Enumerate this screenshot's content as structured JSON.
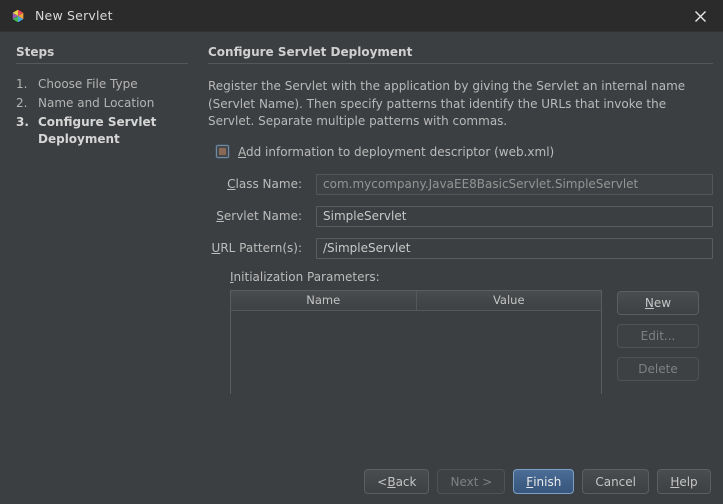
{
  "window": {
    "title": "New Servlet",
    "app_icon": "netbeans-logo-icon",
    "close_icon": "close-icon"
  },
  "steps_panel": {
    "heading": "Steps",
    "items": [
      {
        "number": "1.",
        "label": "Choose File Type",
        "current": false
      },
      {
        "number": "2.",
        "label": "Name and Location",
        "current": false
      },
      {
        "number": "3.",
        "label": "Configure Servlet Deployment",
        "current": true
      }
    ]
  },
  "main": {
    "heading": "Configure Servlet Deployment",
    "description": "Register the Servlet with the application by giving the Servlet an internal name (Servlet Name). Then specify patterns that identify the URLs that invoke the Servlet. Separate multiple patterns with commas.",
    "deployment_descriptor_checkbox": {
      "label_before": "A",
      "label_mnemonic": "A",
      "label": "Add information to deployment descriptor (web.xml)",
      "checked": false
    },
    "fields": [
      {
        "label": "Class Name:",
        "mnemonic": "C",
        "label_rest": "lass Name:",
        "value": "com.mycompany.JavaEE8BasicServlet.SimpleServlet",
        "placeholder": "",
        "disabled": true
      },
      {
        "label": "Servlet Name:",
        "mnemonic": "S",
        "label_rest": "ervlet Name:",
        "value": "SimpleServlet",
        "placeholder": "",
        "disabled": false
      },
      {
        "label": "URL Pattern(s):",
        "mnemonic": "U",
        "label_rest": "RL Pattern(s):",
        "value": "/SimpleServlet",
        "placeholder": "",
        "disabled": false
      }
    ],
    "init_params": {
      "label": "Initialization Parameters:",
      "mnemonic": "I",
      "label_rest": "nitialization Parameters:",
      "columns": [
        "Name",
        "Value"
      ],
      "rows": [],
      "buttons": [
        {
          "label": "New",
          "mnemonic": "N",
          "label_rest": "ew",
          "disabled": false
        },
        {
          "label": "Edit...",
          "mnemonic": "",
          "label_rest": "Edit...",
          "disabled": true
        },
        {
          "label": "Delete",
          "mnemonic": "",
          "label_rest": "Delete",
          "disabled": true
        }
      ]
    }
  },
  "footer": {
    "buttons": [
      {
        "label": "< Back",
        "prefix": "< ",
        "mnemonic": "B",
        "suffix": "ack",
        "disabled": false,
        "default": false
      },
      {
        "label": "Next >",
        "prefix": "",
        "mnemonic": "",
        "suffix": "Next >",
        "disabled": true,
        "default": false
      },
      {
        "label": "Finish",
        "prefix": "",
        "mnemonic": "F",
        "suffix": "inish",
        "disabled": false,
        "default": true
      },
      {
        "label": "Cancel",
        "prefix": "",
        "mnemonic": "",
        "suffix": "Cancel",
        "disabled": false,
        "default": false
      },
      {
        "label": "Help",
        "prefix": "",
        "mnemonic": "H",
        "suffix": "elp",
        "disabled": false,
        "default": false
      }
    ]
  },
  "colors": {
    "window_bg": "#3c3f41",
    "titlebar_bg": "#2b2b2b",
    "text": "#bbbbbb",
    "accent_default_button": "#3f5f87",
    "border": "#5a5d5f"
  }
}
